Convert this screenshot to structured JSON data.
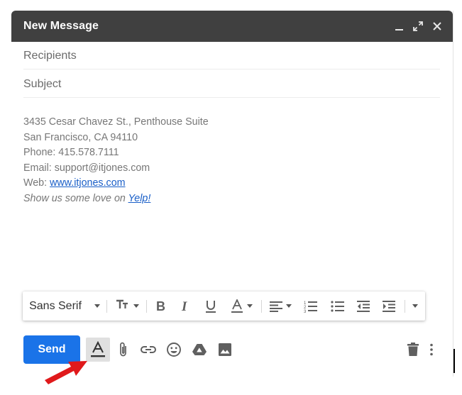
{
  "window": {
    "title": "New Message",
    "controls": [
      "minimize-icon",
      "expand-icon",
      "close-icon"
    ]
  },
  "fields": {
    "recipients_placeholder": "Recipients",
    "subject_placeholder": "Subject"
  },
  "signature": {
    "address": "3435 Cesar Chavez St., Penthouse Suite",
    "city": "San Francisco, CA 94110",
    "phone": "Phone: 415.578.7111",
    "email": "Email: support@itjones.com",
    "web_label": "Web: ",
    "web_link": "www.itjones.com",
    "love_text": "Show us some love on ",
    "love_link": "Yelp!"
  },
  "format_toolbar": {
    "font": "Sans Serif",
    "icons": [
      "font-size-icon",
      "bold-icon",
      "italic-icon",
      "underline-icon",
      "text-color-icon",
      "align-icon",
      "numbered-list-icon",
      "bulleted-list-icon",
      "indent-less-icon",
      "indent-more-icon",
      "more-options-icon"
    ]
  },
  "bottom_bar": {
    "send_label": "Send",
    "icons": [
      "formatting-options-icon",
      "attach-icon",
      "link-icon",
      "emoji-icon",
      "drive-icon",
      "photo-icon",
      "trash-icon",
      "more-vert-icon"
    ]
  },
  "colors": {
    "titlebar": "#404040",
    "send_button": "#1a73e8",
    "link": "#1a5fc8",
    "annotation_arrow": "#e0191b"
  }
}
